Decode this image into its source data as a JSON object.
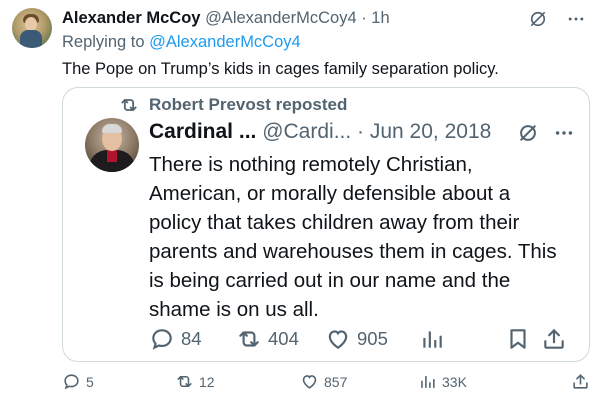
{
  "tweet": {
    "author_name": "Alexander McCoy",
    "author_handle": "@AlexanderMcCoy4",
    "time": " · 1h",
    "replying_prefix": "Replying to ",
    "replying_to": "@AlexanderMcCoy4",
    "text": "The Pope on Trump’s kids in cages family separation policy."
  },
  "quote": {
    "repost_label": "Robert Prevost reposted",
    "name": "Cardinal ...",
    "handle_date": "@Cardi...  · Jun 20, 2018",
    "text_lines": [
      "There is nothing remotely Christian,",
      "American, or morally defensible about a",
      "policy that takes children away from their",
      "parents and warehouses them in cages. This",
      "is being carried out in our name and the",
      "shame is on us all."
    ],
    "actions": {
      "replies": "84",
      "reposts": "404",
      "likes": "905"
    }
  },
  "bottom_actions": {
    "replies": "5",
    "reposts": "12",
    "likes": "857",
    "views": "33K"
  },
  "colors": {
    "text": "#0f1419",
    "muted": "#536471",
    "link": "#1d9bf0",
    "border": "#cfd9de"
  },
  "icons": [
    "grok-icon",
    "more-icon",
    "repost-icon",
    "reply-icon",
    "like-icon",
    "views-icon",
    "bookmark-icon",
    "share-icon"
  ]
}
